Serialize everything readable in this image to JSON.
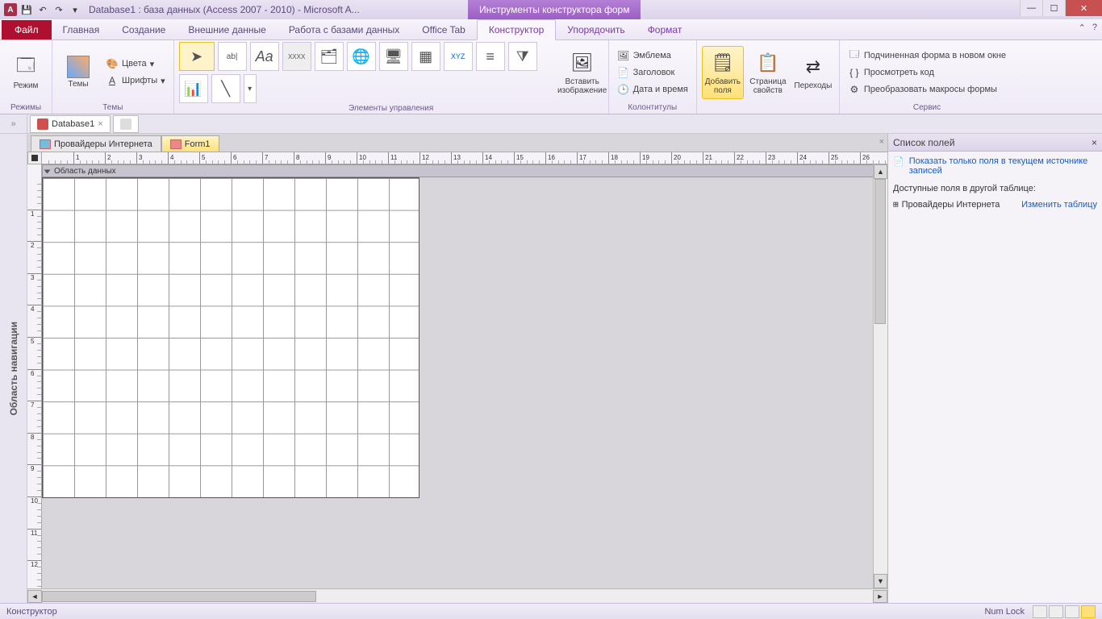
{
  "titlebar": {
    "app_letter": "A",
    "title": "Database1 : база данных (Access 2007 - 2010)  -  Microsoft A...",
    "context_title": "Инструменты конструктора форм"
  },
  "tabs": {
    "file": "Файл",
    "items": [
      "Главная",
      "Создание",
      "Внешние данные",
      "Работа с базами данных",
      "Office Tab",
      "Конструктор",
      "Упорядочить",
      "Формат"
    ],
    "active_index": 5
  },
  "ribbon": {
    "group_modes": {
      "label": "Режимы",
      "btn": "Режим"
    },
    "group_themes": {
      "label": "Темы",
      "btn": "Темы",
      "colors": "Цвета",
      "fonts": "Шрифты"
    },
    "group_controls": {
      "label": "Элементы управления",
      "insert_image": "Вставить\nизображение"
    },
    "group_headers": {
      "label": "Колонтитулы",
      "logo": "Эмблема",
      "title": "Заголовок",
      "datetime": "Дата и время"
    },
    "group_tools": {
      "add_fields": "Добавить\nполя",
      "prop_sheet": "Страница\nсвойств",
      "tab_order": "Переходы"
    },
    "group_service": {
      "label": "Сервис",
      "subform": "Подчиненная форма в новом окне",
      "view_code": "Просмотреть код",
      "convert_macros": "Преобразовать макросы формы"
    }
  },
  "doc_tabs": {
    "db": "Database1"
  },
  "nav_strip": "Область навигации",
  "form_tabs": {
    "table": "Провайдеры Интернета",
    "form": "Form1"
  },
  "section_header": "Область данных",
  "pane": {
    "title": "Список полей",
    "show_current": "Показать только поля в текущем источнике записей",
    "available": "Доступные поля в другой таблице:",
    "table": "Провайдеры Интернета",
    "edit": "Изменить таблицу"
  },
  "status": {
    "left": "Конструктор",
    "numlock": "Num Lock"
  }
}
